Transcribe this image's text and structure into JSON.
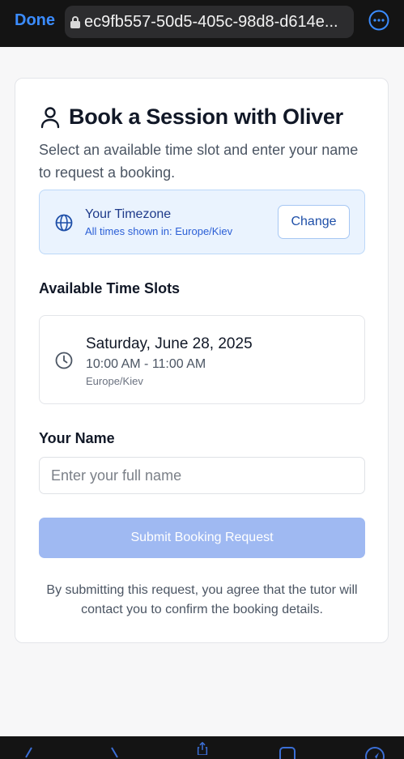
{
  "browser": {
    "done_label": "Done",
    "url": "ec9fb557-50d5-405c-98d8-d614e..."
  },
  "booking": {
    "title": "Book a Session with Oliver",
    "subtitle": "Select an available time slot and enter your name to request a booking.",
    "timezone": {
      "title": "Your Timezone",
      "subtitle": "All times shown in: Europe/Kiev",
      "change_label": "Change"
    },
    "slots_label": "Available Time Slots",
    "slots": [
      {
        "date": "Saturday, June 28, 2025",
        "time": "10:00 AM - 11:00 AM",
        "timezone": "Europe/Kiev"
      }
    ],
    "name_label": "Your Name",
    "name_placeholder": "Enter your full name",
    "name_value": "",
    "submit_label": "Submit Booking Request",
    "disclaimer": "By submitting this request, you agree that the tutor will contact you to confirm the booking details."
  },
  "colors": {
    "accent": "#3b8cff",
    "timezone_bg": "#eaf3fe",
    "submit_disabled": "#9fb9f2"
  }
}
